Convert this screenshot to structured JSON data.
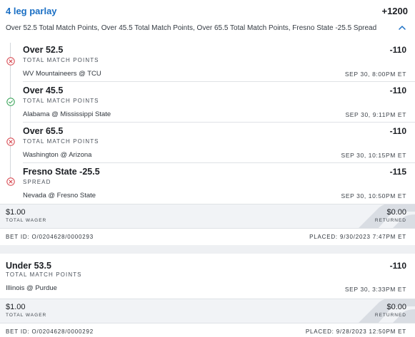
{
  "parlay": {
    "title": "4 leg parlay",
    "odds": "+1200",
    "summary": "Over 52.5 Total Match Points, Over 45.5 Total Match Points, Over 65.5 Total Match Points, Fresno State -25.5 Spread",
    "legs": [
      {
        "name": "Over 52.5",
        "market": "TOTAL MATCH POINTS",
        "event": "WV Mountaineers @ TCU",
        "time": "SEP 30, 8:00PM ET",
        "odds": "-110",
        "status": "lost"
      },
      {
        "name": "Over 45.5",
        "market": "TOTAL MATCH POINTS",
        "event": "Alabama @ Mississippi State",
        "time": "SEP 30, 9:11PM ET",
        "odds": "-110",
        "status": "won"
      },
      {
        "name": "Over 65.5",
        "market": "TOTAL MATCH POINTS",
        "event": "Washington @ Arizona",
        "time": "SEP 30, 10:15PM ET",
        "odds": "-110",
        "status": "lost"
      },
      {
        "name": "Fresno State -25.5",
        "market": "SPREAD",
        "event": "Nevada @ Fresno State",
        "time": "SEP 30, 10:50PM ET",
        "odds": "-115",
        "status": "lost"
      }
    ],
    "wager": "$1.00",
    "wager_label": "TOTAL WAGER",
    "returned": "$0.00",
    "returned_label": "RETURNED",
    "bet_id": "BET ID: O/0204628/0000293",
    "placed": "PLACED: 9/30/2023 7:47PM ET"
  },
  "single": {
    "name": "Under 53.5",
    "market": "TOTAL MATCH POINTS",
    "event": "Illinois @ Purdue",
    "time": "SEP 30, 3:33PM ET",
    "odds": "-110",
    "wager": "$1.00",
    "wager_label": "TOTAL WAGER",
    "returned": "$0.00",
    "returned_label": "RETURNED",
    "bet_id": "BET ID: O/0204628/0000292",
    "placed": "PLACED: 9/28/2023 12:50PM ET"
  },
  "colors": {
    "accent": "#1a6fc4",
    "lost": "#d6424a",
    "won": "#2e9e4f"
  }
}
